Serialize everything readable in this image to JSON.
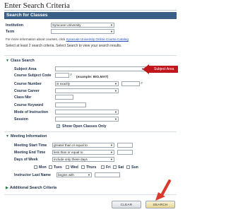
{
  "page": {
    "title": "Enter Search Criteria",
    "banner": "Search for Classes"
  },
  "top": {
    "institution_label": "Institution",
    "institution_value": "Syracuse University",
    "term_label": "Term",
    "term_value": "",
    "info_text": "For more information about courses, click",
    "info_link": "Syracuse University Online Course Catalog",
    "instruction": "Select at least 2 search criteria. Select Search to view your search results."
  },
  "class_search": {
    "header": "Class Search",
    "subject_area_label": "Subject Area",
    "subject_area_value": "",
    "subject_code_label": "Course Subject Code",
    "subject_code_hint": "(example: BIO,MAT)",
    "course_number_label": "Course Number",
    "course_number_op": "is exactly",
    "course_career_label": "Course Career",
    "class_nbr_label": "Class Nbr",
    "course_keyword_label": "Course Keyword",
    "mode_label": "Mode of Instruction",
    "session_label": "Session",
    "show_open_label": "Show Open Classes Only",
    "show_open_checked": true
  },
  "callout": {
    "label": "Subject Area",
    "color": "#c0161c"
  },
  "meeting": {
    "header": "Meeting Information",
    "start_label": "Meeting Start Time",
    "start_op": "greater than or equal to",
    "end_label": "Meeting End Time",
    "end_op": "less than or equal to",
    "days_label": "Days of Week",
    "days_op": "include only these days",
    "days": [
      "Mon",
      "Tues",
      "Wed",
      "Thurs",
      "Fri",
      "Sat",
      "Sun"
    ],
    "instructor_label": "Instructor Last Name",
    "instructor_op": "begins with"
  },
  "additional": {
    "header": "Additional Search Criteria"
  },
  "buttons": {
    "clear": "CLEAR",
    "search": "SEARCH"
  },
  "colors": {
    "banner": "#3a5f86",
    "accent_arrow": "#d93a2b",
    "link": "#1f4fb0"
  }
}
